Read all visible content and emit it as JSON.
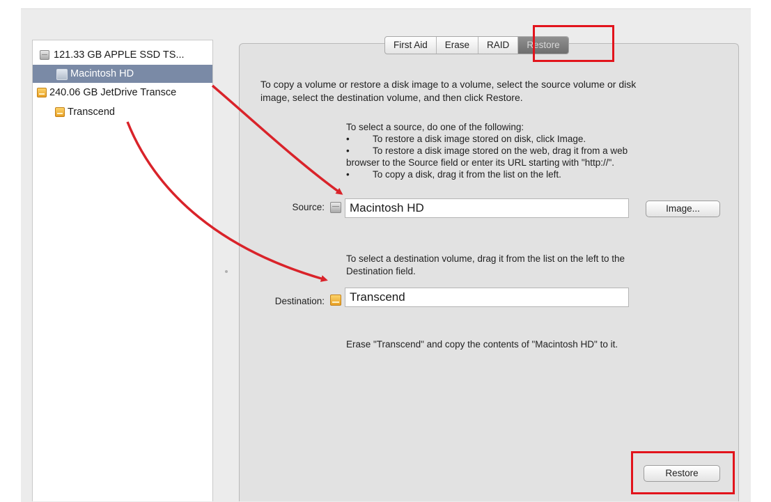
{
  "sidebar": {
    "items": [
      {
        "label": "121.33 GB APPLE SSD TS...",
        "icon": "internal-disk-icon"
      },
      {
        "label": "Macintosh HD",
        "icon": "volume-icon",
        "selected": true
      },
      {
        "label": "240.06 GB JetDrive Transce",
        "icon": "external-disk-icon"
      },
      {
        "label": "Transcend",
        "icon": "external-volume-icon"
      }
    ]
  },
  "tabs": [
    {
      "label": "First Aid"
    },
    {
      "label": "Erase"
    },
    {
      "label": "RAID"
    },
    {
      "label": "Restore",
      "active": true
    }
  ],
  "restore": {
    "intro_line1": "To copy a volume or restore a disk image to a volume, select the source volume or disk",
    "intro_line2": "image, select the destination volume, and then click Restore.",
    "source_help": {
      "title": "To select a source, do one of the following:",
      "bullet1": "To restore a disk image stored on disk, click Image.",
      "bullet2_line1": "To restore a disk image stored on the web, drag it from a web",
      "bullet2_line2": "browser to the Source field or enter its URL starting with \"http://\".",
      "bullet3": "To copy a disk, drag it from the list on the left.",
      "bullet_char": "•"
    },
    "source_label": "Source:",
    "source_value": "Macintosh HD",
    "image_button": "Image...",
    "dest_help_line1": "To select a destination volume, drag it from the list on the left to the",
    "dest_help_line2": "Destination field.",
    "destination_label": "Destination:",
    "destination_value": "Transcend",
    "summary": "Erase \"Transcend\" and copy the contents of \"Macintosh HD\" to it.",
    "restore_button": "Restore"
  },
  "colors": {
    "highlight": "#e2141c",
    "arrow": "#d9232a",
    "selection": "#7a8aa6"
  }
}
